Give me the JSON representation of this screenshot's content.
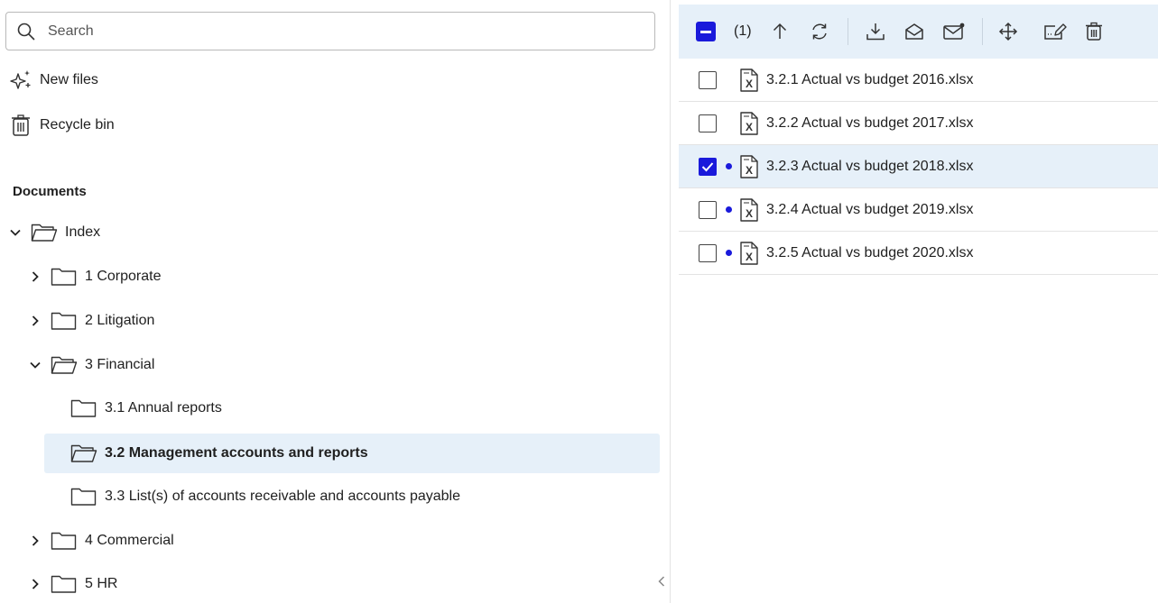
{
  "search": {
    "placeholder": "Search"
  },
  "nav": {
    "new_files": "New files",
    "recycle_bin": "Recycle bin"
  },
  "documents": {
    "title": "Documents",
    "tree": [
      {
        "label": "Index",
        "expanded": true,
        "level": 0
      },
      {
        "label": "1 Corporate",
        "expanded": false,
        "level": 1
      },
      {
        "label": "2 Litigation",
        "expanded": false,
        "level": 1
      },
      {
        "label": "3 Financial",
        "expanded": true,
        "level": 1
      },
      {
        "label": "3.1 Annual reports",
        "level": 2
      },
      {
        "label": "3.2 Management accounts and reports",
        "level": 2,
        "selected": true
      },
      {
        "label": "3.3 List(s) of accounts receivable and accounts payable",
        "level": 2
      },
      {
        "label": "4 Commercial",
        "expanded": false,
        "level": 1
      },
      {
        "label": "5 HR",
        "expanded": false,
        "level": 1
      }
    ]
  },
  "toolbar": {
    "selected_count": "(1)",
    "actions": [
      "up-arrow-icon",
      "refresh-icon",
      "download-icon",
      "mark-read-icon",
      "mark-unread-icon",
      "move-icon",
      "rename-icon",
      "delete-icon"
    ]
  },
  "files": [
    {
      "name": "3.2.1 Actual vs budget 2016.xlsx",
      "checked": false,
      "unread": false
    },
    {
      "name": "3.2.2 Actual vs budget 2017.xlsx",
      "checked": false,
      "unread": false
    },
    {
      "name": "3.2.3 Actual vs budget 2018.xlsx",
      "checked": true,
      "unread": true
    },
    {
      "name": "3.2.4 Actual vs budget 2019.xlsx",
      "checked": false,
      "unread": true
    },
    {
      "name": "3.2.5 Actual vs budget 2020.xlsx",
      "checked": false,
      "unread": true
    }
  ],
  "colors": {
    "accent": "#1a1adb",
    "selected_bg": "#e6f0f9"
  }
}
